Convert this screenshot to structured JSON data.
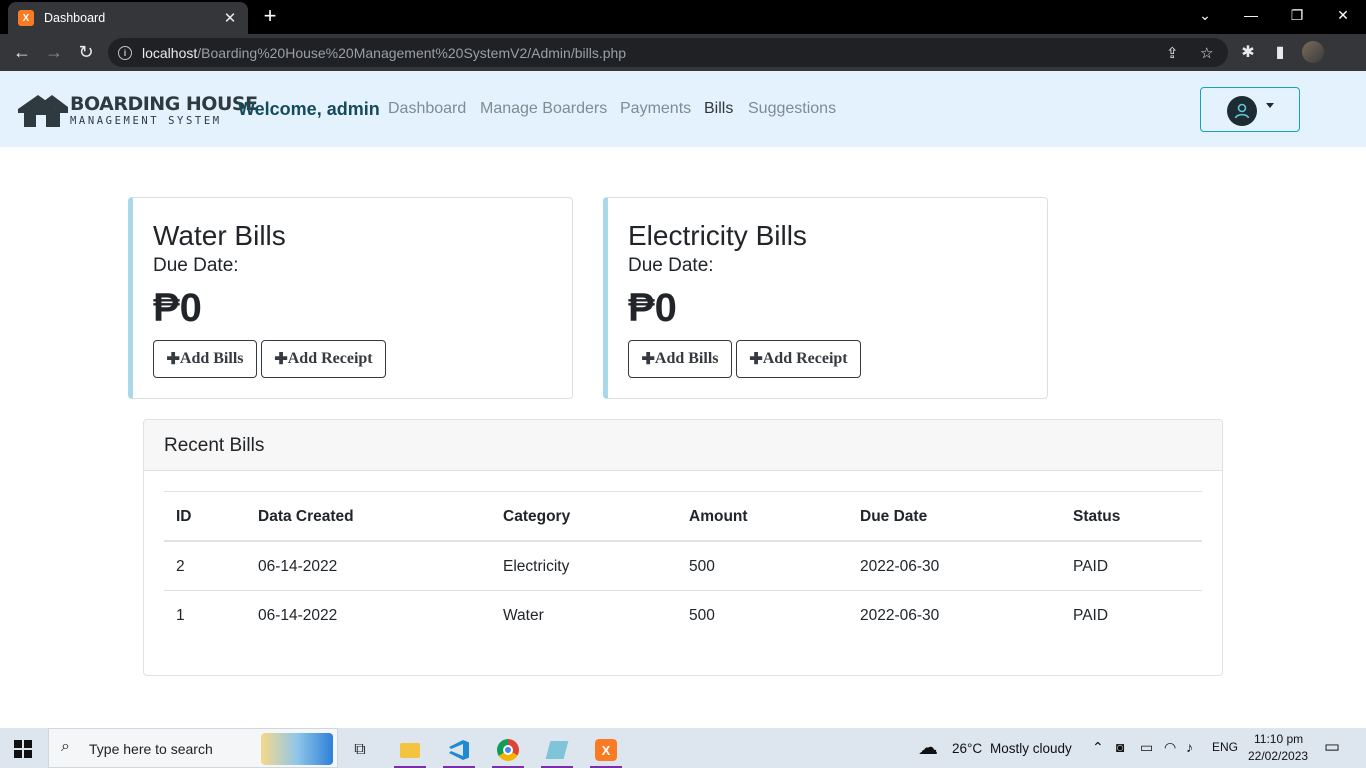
{
  "browser": {
    "tab_title": "Dashboard",
    "tab_favicon": "xampp-icon",
    "url_host": "localhost",
    "url_path": "/Boarding%20House%20Management%20SystemV2/Admin/bills.php"
  },
  "site": {
    "logo_line1": "BOARDING HOUSE",
    "logo_line2": "MANAGEMENT SYSTEM",
    "welcome": "Welcome, admin",
    "nav": [
      "Dashboard",
      "Manage Boarders",
      "Payments",
      "Bills",
      "Suggestions"
    ],
    "active_nav": "Bills"
  },
  "cards": [
    {
      "title": "Water Bills",
      "due_label": "Due Date:",
      "amount": "₱0",
      "add_bills": "Add Bills",
      "add_receipt": "Add Receipt"
    },
    {
      "title": "Electricity Bills",
      "due_label": "Due Date:",
      "amount": "₱0",
      "add_bills": "Add Bills",
      "add_receipt": "Add Receipt"
    }
  ],
  "recent_bills": {
    "title": "Recent Bills",
    "columns": [
      "ID",
      "Data Created",
      "Category",
      "Amount",
      "Due Date",
      "Status"
    ],
    "rows": [
      [
        "2",
        "06-14-2022",
        "Electricity",
        "500",
        "2022-06-30",
        "PAID"
      ],
      [
        "1",
        "06-14-2022",
        "Water",
        "500",
        "2022-06-30",
        "PAID"
      ]
    ]
  },
  "taskbar": {
    "search_placeholder": "Type here to search",
    "weather_temp": "26°C",
    "weather_desc": "Mostly cloudy",
    "language": "ENG",
    "time": "11:10 pm",
    "date": "22/02/2023"
  },
  "colors": {
    "nav_bg": "#e3f2fd",
    "card_accent": "#a9d8ea",
    "welcome_text": "#164b5b",
    "user_button_border": "#17a2b8"
  }
}
